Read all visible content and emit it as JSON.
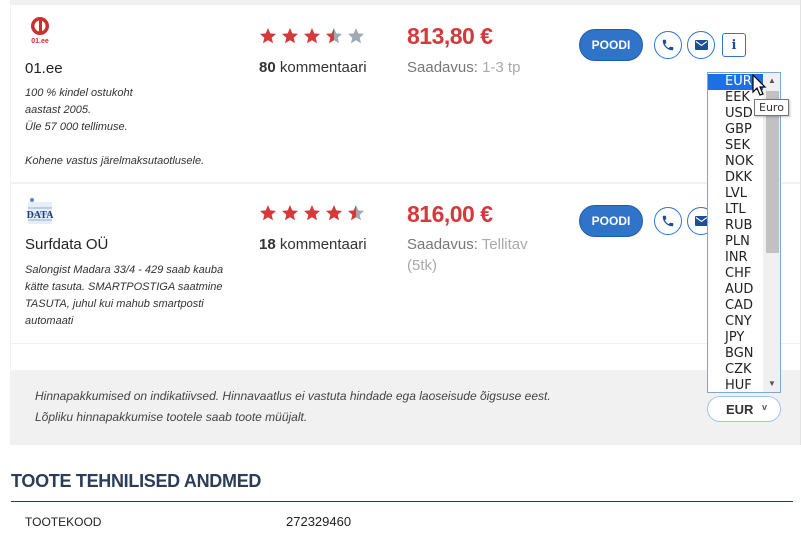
{
  "offers": [
    {
      "logo_text": "01.ee",
      "shop_name": "01.ee",
      "description_lines": [
        "100 % kindel ostukoht",
        "aastast 2005.",
        "Üle 57 000 tellimuse.",
        "",
        "Kohene vastus järelmaksutaotlusele."
      ],
      "rating": 3.5,
      "comment_count": "80",
      "comments_label": "kommentaari",
      "price": "813,80 €",
      "availability_label": "Saadavus:",
      "availability_value": "1-3 tp",
      "buy_label": "POODI"
    },
    {
      "logo_text": "DATA",
      "shop_name": "Surfdata OÜ",
      "description_lines": [
        "Salongist Madara 33/4 - 429 saab kauba",
        "kätte tasuta. SMARTPOSTIGA saatmine",
        "TASUTA, juhul kui mahub smartposti",
        "automaati"
      ],
      "rating": 4.5,
      "comment_count": "18",
      "comments_label": "kommentaari",
      "price": "816,00 €",
      "availability_label": "Saadavus:",
      "availability_value": "Tellitav (5tk)",
      "buy_label": "POODI"
    }
  ],
  "disclaimer": {
    "line1": "Hinnapakkumised on indikatiivsed. Hinnavaatlus ei vastuta hindade ega laoseisude õigsuse eest.",
    "line2": "Lõpliku hinnapakkumise tootele saab toote müüjalt."
  },
  "currency": {
    "selected": "EUR",
    "options": [
      "EUR",
      "EEK",
      "USD",
      "GBP",
      "SEK",
      "NOK",
      "DKK",
      "LVL",
      "LTL",
      "RUB",
      "PLN",
      "INR",
      "CHF",
      "AUD",
      "CAD",
      "CNY",
      "JPY",
      "BGN",
      "CZK",
      "HUF"
    ],
    "highlighted": "EUR",
    "tooltip": "Euro"
  },
  "specs": {
    "title": "TOOTE TEHNILISED ANDMED",
    "rows": [
      {
        "key": "TOOTEKOOD",
        "value": "272329460"
      }
    ]
  },
  "colors": {
    "accent_blue": "#2f74c9",
    "price_red": "#d4393b",
    "star_red": "#d4393b",
    "star_gray": "#a0a8b4",
    "heading_navy": "#2b3d57"
  }
}
